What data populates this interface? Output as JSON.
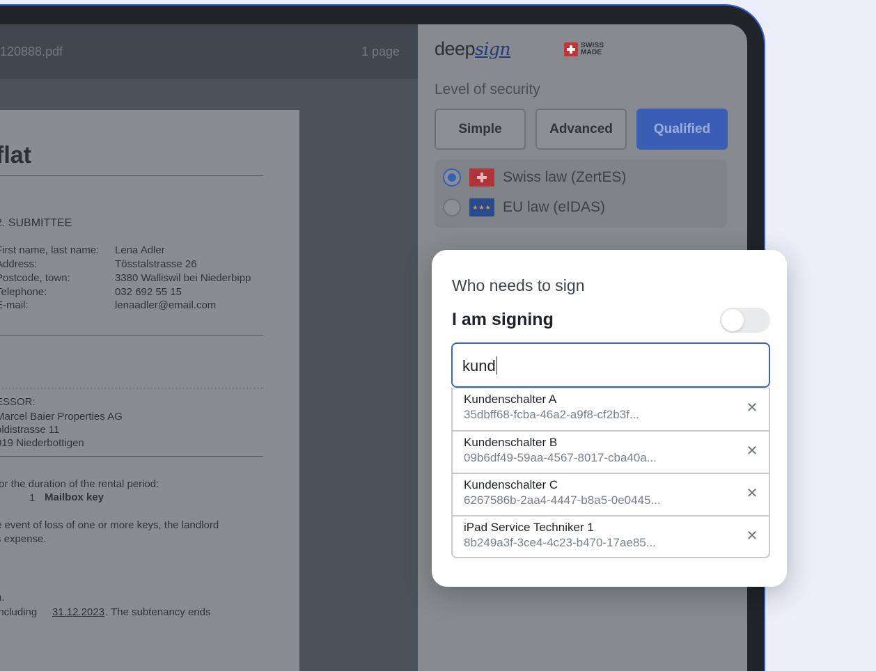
{
  "pdf": {
    "filename": "120888.pdf",
    "pages": "1 page",
    "title": "flat",
    "section": "2.  SUBMITTEE",
    "fields": [
      {
        "label": "First name, last name:",
        "value": "Lena Adler"
      },
      {
        "label": "Address:",
        "value": "Tösstalstrasse 26"
      },
      {
        "label": "Postcode, town:",
        "value": "3380 Walliswil bei Niederbipp"
      },
      {
        "label": "Telephone:",
        "value": "032 692 55 15"
      },
      {
        "label": "E-mail:",
        "value": "lenaadler@email.com"
      }
    ],
    "lessor_label": "ESSOR:",
    "lessor_lines": [
      "Marcel Baier Properties AG",
      "oldistrasse 11",
      "019 Niederbottigen"
    ],
    "duration_line": "for the duration of the rental period:",
    "key_count": "1",
    "key_name": "Mailbox key",
    "loss_line1": "e event of loss of one or more keys, the landlord",
    "loss_line2": "s expense.",
    "end_line0": "n.",
    "end_prefix": "including",
    "end_date": "31.12.2023",
    "end_suffix": ". The subtenancy ends"
  },
  "panel": {
    "logo_main": "deep",
    "logo_script": "sign",
    "swiss_line1": "SWISS",
    "swiss_line2": "MADE",
    "security_label": "Level of security",
    "security_options": [
      "Simple",
      "Advanced",
      "Qualified"
    ],
    "laws": [
      {
        "label": "Swiss law (ZertES)",
        "selected": true
      },
      {
        "label": "EU law (eIDAS)",
        "selected": false
      }
    ]
  },
  "signers": {
    "title": "Who needs to sign",
    "self_label": "I am signing",
    "self_toggle": false,
    "search_value": "kund",
    "results": [
      {
        "name": "Kundenschalter A",
        "id": "35dbff68-fcba-46a2-a9f8-cf2b3f..."
      },
      {
        "name": "Kundenschalter B",
        "id": "09b6df49-59aa-4567-8017-cba40a..."
      },
      {
        "name": "Kundenschalter C",
        "id": "6267586b-2aa4-4447-b8a5-0e0445..."
      },
      {
        "name": "iPad Service Techniker 1",
        "id": "8b249a3f-3ce4-4c23-b470-17ae85..."
      }
    ]
  },
  "colors": {
    "accent": "#3a63c8",
    "frame": "#212527",
    "background": "#eceff9"
  }
}
